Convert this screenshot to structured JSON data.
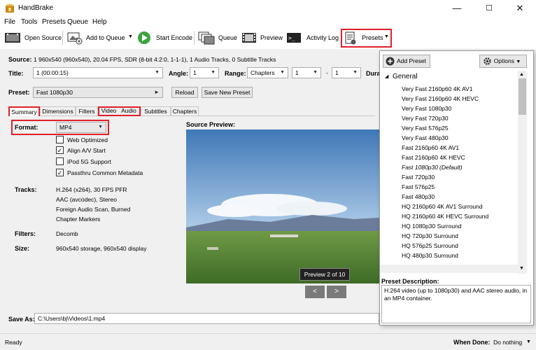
{
  "window": {
    "title": "HandBrake",
    "min": "—",
    "max": "☐",
    "close": "✕"
  },
  "menu": [
    "File",
    "Tools",
    "Presets",
    "Queue",
    "Help"
  ],
  "toolbar": {
    "open_source": "Open Source",
    "add_to_queue": "Add to Queue",
    "start_encode": "Start Encode",
    "queue": "Queue",
    "preview": "Preview",
    "activity_log": "Activity Log",
    "presets": "Presets"
  },
  "source": {
    "label": "Source:",
    "value": "1   960x540 (960x540), 20.04 FPS, SDR (8-bit 4:2:0, 1-1-1), 1 Audio Tracks, 0 Subtitle Tracks"
  },
  "title_row": {
    "title_label": "Title:",
    "title_value": "1 (00:00:15)",
    "angle_label": "Angle:",
    "angle_value": "1",
    "range_label": "Range:",
    "range_value": "Chapters",
    "range_start": "1",
    "dash": "-",
    "range_end": "1",
    "duration_label": "Dura"
  },
  "preset_row": {
    "label": "Preset:",
    "value": "Fast 1080p30",
    "reload": "Reload",
    "save_new": "Save New Preset"
  },
  "tabs": [
    "Summary",
    "Dimensions",
    "Filters",
    "Video",
    "Audio",
    "Subtitles",
    "Chapters"
  ],
  "summary": {
    "format_label": "Format:",
    "format_value": "MP4",
    "opt_web": "Web Optimized",
    "opt_align": "Align A/V Start",
    "opt_ipod": "iPod 5G Support",
    "opt_passthru": "Passthru Common Metadata",
    "tracks_label": "Tracks:",
    "tracks": [
      "H.264 (x264), 30 FPS PFR",
      "AAC (avcodec), Stereo",
      "Foreign Audio Scan, Burned",
      "Chapter Markers"
    ],
    "filters_label": "Filters:",
    "filters_value": "Decomb",
    "size_label": "Size:",
    "size_value": "960x540 storage, 960x540 display"
  },
  "preview": {
    "label": "Source Preview:",
    "badge": "Preview 2 of 10",
    "prev": "<",
    "next": ">"
  },
  "save": {
    "label": "Save As:",
    "value": "C:\\Users\\bj\\Videos\\1.mp4"
  },
  "status": {
    "ready": "Ready",
    "when_done_label": "When Done:",
    "when_done_value": "Do nothing"
  },
  "presets_panel": {
    "add": "Add Preset",
    "options": "Options",
    "group": "General",
    "items": [
      "Very Fast 2160p60 4K AV1",
      "Very Fast 2160p60 4K HEVC",
      "Very Fast 1080p30",
      "Very Fast 720p30",
      "Very Fast 576p25",
      "Very Fast 480p30",
      "Fast 2160p60 4K AV1",
      "Fast 2160p60 4K HEVC",
      "Fast 1080p30",
      "Fast 720p30",
      "Fast 576p25",
      "Fast 480p30",
      "HQ 2160p60 4K AV1 Surround",
      "HQ 2160p60 4K HEVC Surround",
      "HQ 1080p30 Surround",
      "HQ 720p30 Surround",
      "HQ 576p25 Surround",
      "HQ 480p30 Surround"
    ],
    "default_tag": "(Default)",
    "desc_label": "Preset Description:",
    "desc": "H.264 video (up to 1080p30) and AAC stereo audio, in an MP4 container."
  }
}
